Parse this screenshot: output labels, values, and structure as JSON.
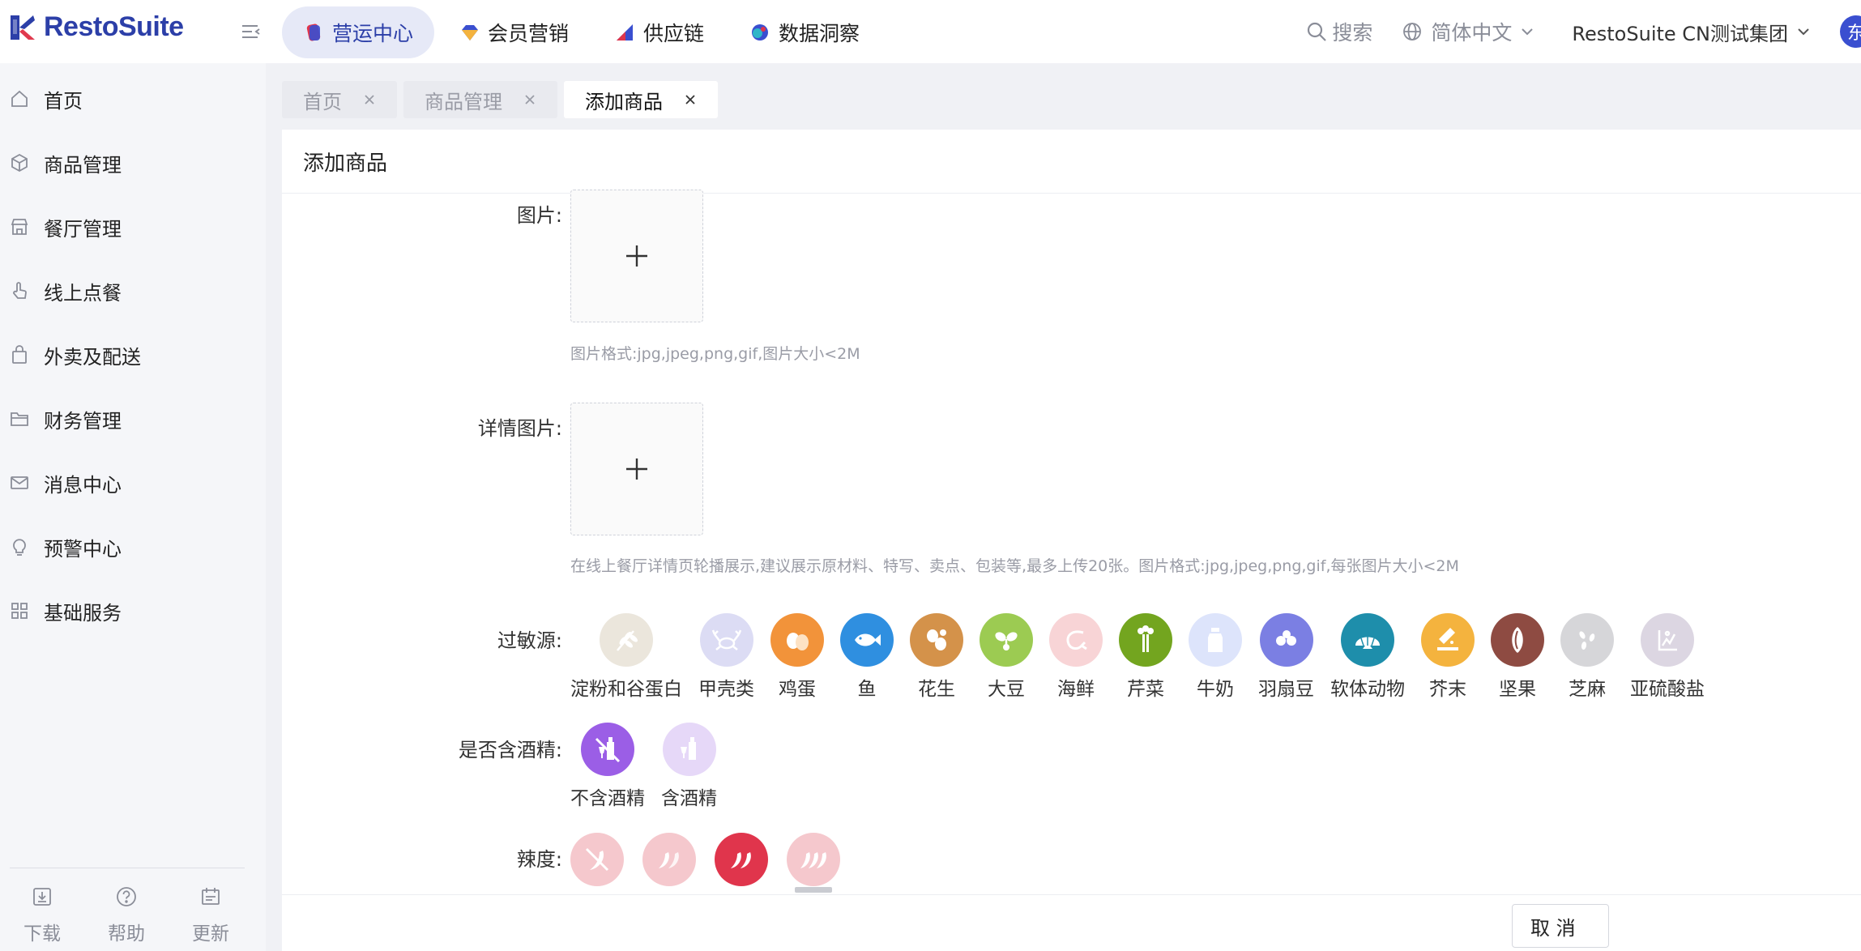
{
  "brand": {
    "name": "RestoSuite"
  },
  "modules": [
    {
      "label": "营运中心",
      "active": true
    },
    {
      "label": "会员营销",
      "active": false
    },
    {
      "label": "供应链",
      "active": false
    },
    {
      "label": "数据洞察",
      "active": false
    }
  ],
  "header": {
    "search_label": "搜索",
    "language": "简体中文",
    "organization": "RestoSuite CN测试集团",
    "avatar_text": "东"
  },
  "sidebar": {
    "items": [
      {
        "label": "首页",
        "icon": "home-icon"
      },
      {
        "label": "商品管理",
        "icon": "cube-icon"
      },
      {
        "label": "餐厅管理",
        "icon": "store-icon"
      },
      {
        "label": "线上点餐",
        "icon": "hand-pointer-icon"
      },
      {
        "label": "外卖及配送",
        "icon": "bag-icon"
      },
      {
        "label": "财务管理",
        "icon": "folder-icon"
      },
      {
        "label": "消息中心",
        "icon": "mail-icon"
      },
      {
        "label": "预警中心",
        "icon": "bulb-icon"
      },
      {
        "label": "基础服务",
        "icon": "grid-icon"
      }
    ],
    "footer": [
      {
        "label": "下载",
        "icon": "download-icon"
      },
      {
        "label": "帮助",
        "icon": "help-icon"
      },
      {
        "label": "更新",
        "icon": "update-icon"
      }
    ]
  },
  "tabs": [
    {
      "label": "首页",
      "active": false
    },
    {
      "label": "商品管理",
      "active": false
    },
    {
      "label": "添加商品",
      "active": true
    }
  ],
  "page": {
    "title": "添加商品",
    "image_label": "图片:",
    "image_hint": "图片格式:jpg,jpeg,png,gif,图片大小<2M",
    "detail_image_label": "详情图片:",
    "detail_image_hint": "在线上餐厅详情页轮播展示,建议展示原材料、特写、卖点、包装等,最多上传20张。图片格式:jpg,jpeg,png,gif,每张图片大小<2M",
    "allergen_label": "过敏源:",
    "alcohol_label": "是否含酒精:",
    "spicy_label": "辣度:",
    "cancel_label": "取 消"
  },
  "allergens": [
    {
      "label": "淀粉和谷蛋白",
      "color": "#ebe6dc",
      "icon": "wheat-icon"
    },
    {
      "label": "甲壳类",
      "color": "#dcdcf4",
      "icon": "crab-icon"
    },
    {
      "label": "鸡蛋",
      "color": "#f2933a",
      "icon": "egg-icon"
    },
    {
      "label": "鱼",
      "color": "#2f8fe0",
      "icon": "fish-icon"
    },
    {
      "label": "花生",
      "color": "#d4924a",
      "icon": "peanut-icon"
    },
    {
      "label": "大豆",
      "color": "#9ccb52",
      "icon": "soybean-icon"
    },
    {
      "label": "海鲜",
      "color": "#f8d4d6",
      "icon": "shrimp-icon"
    },
    {
      "label": "芹菜",
      "color": "#73a51f",
      "icon": "celery-icon"
    },
    {
      "label": "牛奶",
      "color": "#dde4fb",
      "icon": "milk-icon"
    },
    {
      "label": "羽扇豆",
      "color": "#7b7fe3",
      "icon": "lupin-icon"
    },
    {
      "label": "软体动物",
      "color": "#1e8eab",
      "icon": "shell-icon"
    },
    {
      "label": "芥末",
      "color": "#f4b33e",
      "icon": "mustard-icon"
    },
    {
      "label": "坚果",
      "color": "#8e4b42",
      "icon": "nut-icon"
    },
    {
      "label": "芝麻",
      "color": "#d6d6d9",
      "icon": "sesame-icon"
    },
    {
      "label": "亚硫酸盐",
      "color": "#dcd6e2",
      "icon": "sulphite-icon"
    }
  ],
  "alcohol_options": [
    {
      "label": "不含酒精",
      "color": "#9b5ee6",
      "icon": "no-alcohol-icon"
    },
    {
      "label": "含酒精",
      "color": "#e6d8f8",
      "icon": "alcohol-icon"
    }
  ],
  "spicy_levels": [
    {
      "color": "#f5c8cd",
      "icon": "not-spicy-icon"
    },
    {
      "color": "#f5c8cd",
      "icon": "mild-spicy-icon"
    },
    {
      "color": "#e0354c",
      "icon": "medium-spicy-icon"
    },
    {
      "color": "#f5c8cd",
      "icon": "hot-spicy-icon"
    }
  ]
}
